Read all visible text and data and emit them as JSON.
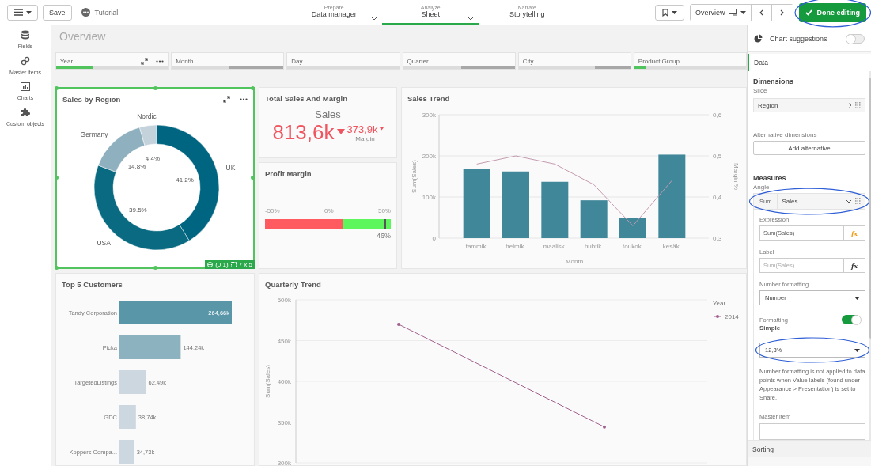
{
  "top_bar": {
    "save": "Save",
    "tutorial": "Tutorial",
    "nav": [
      {
        "caption": "Prepare",
        "label": "Data manager",
        "dropdown": true,
        "selected": false
      },
      {
        "caption": "Analyze",
        "label": "Sheet",
        "dropdown": true,
        "selected": true
      },
      {
        "caption": "Narrate",
        "label": "Storytelling",
        "dropdown": false,
        "selected": false
      }
    ],
    "sheet": "Overview",
    "done": "Done editing"
  },
  "sidebar": {
    "items": [
      {
        "label": "Fields"
      },
      {
        "label": "Master items"
      },
      {
        "label": "Charts"
      },
      {
        "label": "Custom objects"
      }
    ]
  },
  "sheet": {
    "title": "Overview",
    "filters": [
      {
        "label": "Year",
        "kind": "selected",
        "level": 0.33,
        "tools": true
      },
      {
        "label": "Month",
        "kind": "excluded",
        "level": 0.49,
        "tools": false
      },
      {
        "label": "Day",
        "kind": "none",
        "tools": false
      },
      {
        "label": "Quarter",
        "kind": "excluded",
        "level": 0.48,
        "tools": false
      },
      {
        "label": "City",
        "kind": "excluded",
        "level": 0.32,
        "tools": false
      },
      {
        "label": "Product Group",
        "kind": "selected",
        "level": 0.1,
        "tools": false
      }
    ],
    "sales_by_region": {
      "title": "Sales by Region",
      "selected": true,
      "badge": {
        "position": "(0,1)",
        "size": "7 x 5"
      },
      "chart_data": {
        "type": "donut",
        "categories": [
          "UK",
          "USA",
          "Germany",
          "Nordic"
        ],
        "values": [
          41.2,
          39.5,
          14.8,
          4.4
        ],
        "value_labels": [
          "41.2%",
          "39.5%",
          "14.8%",
          "4.4%"
        ],
        "colors": [
          "#006580",
          "#0a6a82",
          "#8fb0bf",
          "#c4d2dc"
        ]
      }
    },
    "total_sales": {
      "title": "Total Sales And Margin",
      "label": "Sales",
      "value": "813,6k",
      "secondary_value": "373,9k",
      "secondary_label": "Margin"
    },
    "profit_margin": {
      "title": "Profit Margin",
      "ticks": [
        "-50%",
        "0%",
        "50%"
      ],
      "level": 0.96,
      "reading": "46%"
    },
    "sales_trend": {
      "title": "Sales Trend",
      "bars": {
        "chart_data": {
          "type": "bar",
          "xlabel": "Month",
          "grid": true,
          "categories": [
            "tammik.",
            "helmik.",
            "maalisk.",
            "huhtik.",
            "toukok.",
            "kesäk."
          ],
          "series": [
            {
              "name": "Sum(Sales)",
              "color": "#3f8799",
              "values": [
                169000,
                162000,
                137000,
                92000,
                49000,
                203000
              ]
            }
          ],
          "ylim": [
            0,
            300000
          ],
          "yticks": [
            {
              "value": 0,
              "label": "0"
            },
            {
              "value": 100000,
              "label": "100k"
            },
            {
              "value": 200000,
              "label": "200k"
            },
            {
              "value": 300000,
              "label": "300k"
            }
          ]
        }
      },
      "margin_line": {
        "chart_data": {
          "type": "line",
          "series": [
            {
              "name": "Margin %",
              "color": "#c49aaf",
              "values": [
                0.48,
                0.5,
                0.48,
                0.43,
                0.33,
                0.44
              ]
            }
          ],
          "ylim": [
            0.3,
            0.6
          ],
          "yticks": [
            {
              "value": 0.3,
              "label": "0,3"
            },
            {
              "value": 0.4,
              "label": "0,4"
            },
            {
              "value": 0.5,
              "label": "0,5"
            },
            {
              "value": 0.6,
              "label": "0,6"
            }
          ]
        }
      }
    },
    "top_customers": {
      "title": "Top 5 Customers",
      "chart_data": {
        "type": "bar",
        "orientation": "horizontal",
        "categories": [
          "Tandy Corporation",
          "Picka",
          "TargetedListings",
          "GDC",
          "Koppers Compa..."
        ],
        "values": [
          264660,
          144240,
          62490,
          38740,
          34730
        ],
        "value_labels": [
          "264,66k",
          "144,24k",
          "62,49k",
          "38,74k",
          "34,73k"
        ],
        "colors": [
          "#5896a8",
          "#8cb2c0",
          "#cdd7df",
          "#cdd7df",
          "#cdd7df"
        ]
      }
    },
    "quarterly_trend": {
      "title": "Quarterly Trend",
      "legend_title": "Year",
      "chart_data": {
        "type": "line",
        "ylabel": "Sum(Sales)",
        "grid": true,
        "ylim": [
          300000,
          500000
        ],
        "yticks": [
          {
            "value": 300000,
            "label": "300k"
          },
          {
            "value": 350000,
            "label": "350k"
          },
          {
            "value": 400000,
            "label": "400k"
          },
          {
            "value": 450000,
            "label": "450k"
          },
          {
            "value": 500000,
            "label": "500k"
          }
        ],
        "series": [
          {
            "name": "2014",
            "color": "#a0608e",
            "values": [
              470000,
              344000
            ]
          }
        ]
      }
    }
  },
  "panel": {
    "suggestions": {
      "label": "Chart suggestions",
      "on": false
    },
    "tabs": [
      {
        "label": "Data",
        "selected": true
      }
    ],
    "dimensions": {
      "heading": "Dimensions",
      "slice_label": "Slice",
      "field": "Region",
      "alt_label": "Alternative dimensions",
      "add_button": "Add alternative"
    },
    "measures": {
      "heading": "Measures",
      "angle_label": "Angle",
      "aggregation": "Sum",
      "field": "Sales",
      "expression_label": "Expression",
      "expression": "Sum(Sales)",
      "expression_fx": "fx",
      "label_label": "Label",
      "label_placeholder": "Sum(Sales)",
      "label_fx": "fx",
      "number_formatting_label": "Number formatting",
      "number_formatting": "Number",
      "formatting_label": "Formatting",
      "formatting_on": true,
      "simple_label": "Simple",
      "format": "12,3%",
      "note": "Number formatting is not applied to data points when Value labels (found under Appearance > Presentation) is set to Share.",
      "master_label": "Master item"
    },
    "sorting": "Sorting"
  }
}
